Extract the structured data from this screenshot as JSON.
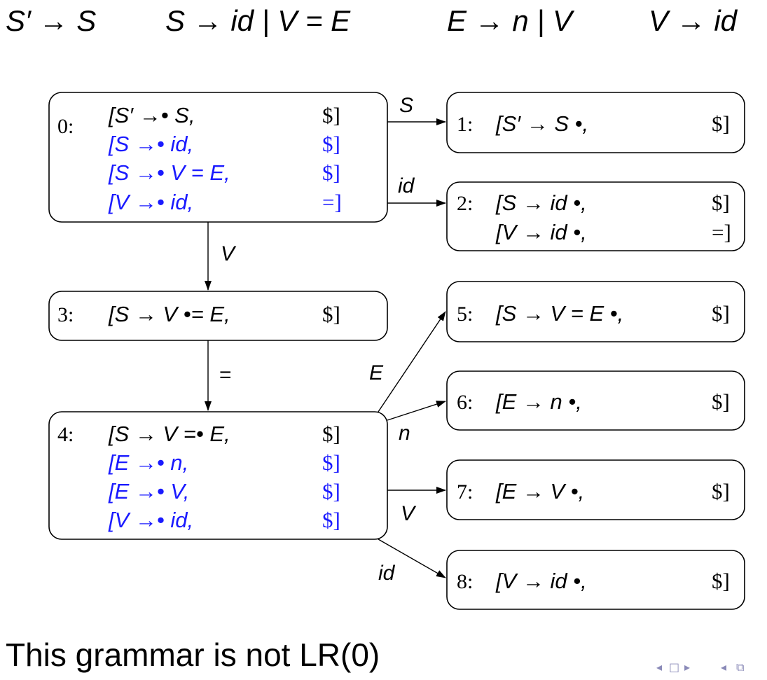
{
  "grammar": {
    "productions": [
      "S′ → S",
      "S → id | V = E",
      "E → n | V",
      "V → id"
    ]
  },
  "states": [
    {
      "id": "0:",
      "items": [
        {
          "text": "[S′ →• S,",
          "la": "$]",
          "closure": false
        },
        {
          "text": "[S →• id,",
          "la": "$]",
          "closure": true
        },
        {
          "text": "[S →• V = E,",
          "la": "$]",
          "closure": true
        },
        {
          "text": "[V →• id,",
          "la": "=]",
          "closure": true
        }
      ]
    },
    {
      "id": "1:",
      "items": [
        {
          "text": "[S′ → S •,",
          "la": "$]",
          "closure": false
        }
      ]
    },
    {
      "id": "2:",
      "items": [
        {
          "text": "[S → id •,",
          "la": "$]",
          "closure": false
        },
        {
          "text": "[V → id •,",
          "la": "=]",
          "closure": false
        }
      ]
    },
    {
      "id": "3:",
      "items": [
        {
          "text": "[S → V •= E,",
          "la": "$]",
          "closure": false
        }
      ]
    },
    {
      "id": "4:",
      "items": [
        {
          "text": "[S → V =• E,",
          "la": "$]",
          "closure": false
        },
        {
          "text": "[E →• n,",
          "la": "$]",
          "closure": true
        },
        {
          "text": "[E →• V,",
          "la": "$]",
          "closure": true
        },
        {
          "text": "[V →• id,",
          "la": "$]",
          "closure": true
        }
      ]
    },
    {
      "id": "5:",
      "items": [
        {
          "text": "[S → V = E •,",
          "la": "$]",
          "closure": false
        }
      ]
    },
    {
      "id": "6:",
      "items": [
        {
          "text": "[E → n •,",
          "la": "$]",
          "closure": false
        }
      ]
    },
    {
      "id": "7:",
      "items": [
        {
          "text": "[E → V •,",
          "la": "$]",
          "closure": false
        }
      ]
    },
    {
      "id": "8:",
      "items": [
        {
          "text": "[V → id •,",
          "la": "$]",
          "closure": false
        }
      ]
    }
  ],
  "transitions": [
    {
      "from": "0",
      "to": "1",
      "label": "S"
    },
    {
      "from": "0",
      "to": "2",
      "label": "id"
    },
    {
      "from": "0",
      "to": "3",
      "label": "V"
    },
    {
      "from": "3",
      "to": "4",
      "label": "="
    },
    {
      "from": "4",
      "to": "5",
      "label": "E"
    },
    {
      "from": "4",
      "to": "6",
      "label": "n"
    },
    {
      "from": "4",
      "to": "7",
      "label": "V"
    },
    {
      "from": "4",
      "to": "8",
      "label": "id"
    }
  ],
  "colors": {
    "closure_items": "#1a1aff",
    "kernel_items": "#000000"
  },
  "footer": {
    "text": "This grammar is not LR(0)"
  },
  "nav": {
    "icons": [
      "nav-prev-icon",
      "frame-icon",
      "nav-next-icon",
      "nav-back-icon",
      "nav-search-icon"
    ]
  }
}
